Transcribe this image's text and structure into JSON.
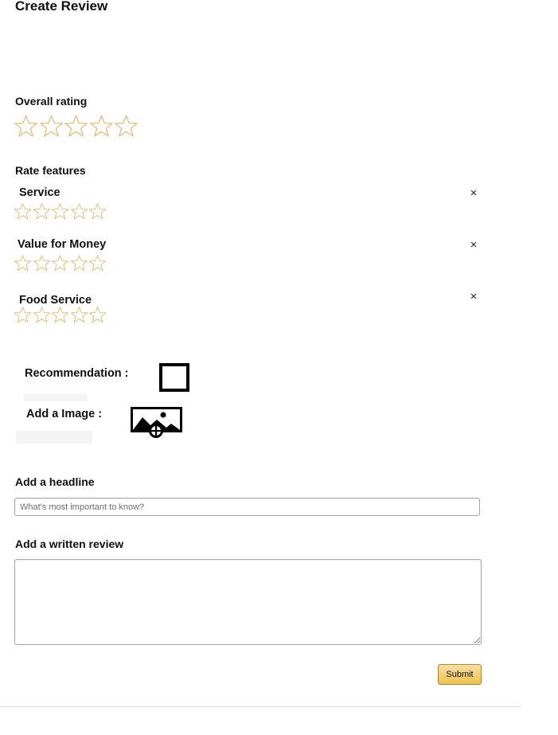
{
  "page": {
    "title": "Create Review"
  },
  "overall": {
    "label": "Overall rating",
    "rating": 0,
    "max": 5
  },
  "features": {
    "label": "Rate features",
    "items": [
      {
        "name": "Service",
        "rating": 0,
        "max": 5,
        "remove": "×"
      },
      {
        "name": "Value for Money",
        "rating": 0,
        "max": 5,
        "remove": "×"
      },
      {
        "name": "Food Service",
        "rating": 0,
        "max": 5,
        "remove": "×"
      }
    ]
  },
  "recommendation": {
    "label": "Recommendation :",
    "checked": false
  },
  "image": {
    "label": "Add a Image :",
    "icon": "add-image-icon"
  },
  "headline": {
    "label": "Add a headline",
    "placeholder": "What's most important to know?",
    "value": ""
  },
  "review": {
    "label": "Add a written review",
    "value": ""
  },
  "submit": {
    "label": "Submit"
  },
  "colors": {
    "star_outline": "#e3bd7a",
    "button_top": "#f7dfa5",
    "button_bottom": "#f0c14b",
    "button_border": "#a88734",
    "input_border": "#a6a6a6"
  }
}
